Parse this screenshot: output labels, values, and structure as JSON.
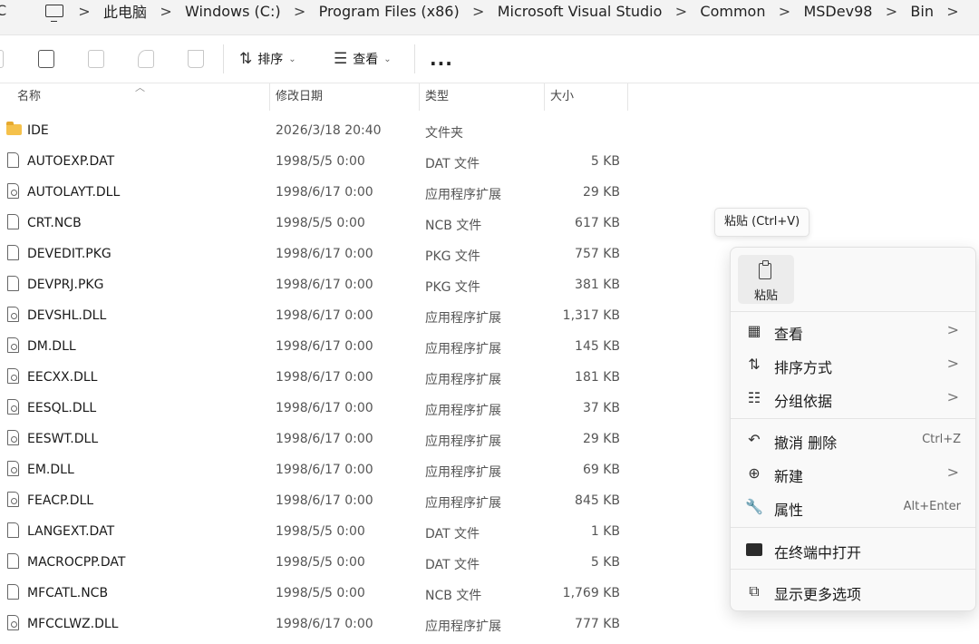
{
  "address": {
    "back_glyph": "C",
    "crumbs": [
      "此电脑",
      "Windows (C:)",
      "Program Files (x86)",
      "Microsoft Visual Studio",
      "Common",
      "MSDev98",
      "Bin"
    ],
    "separator": ">"
  },
  "toolbar": {
    "sort_label": "排序",
    "view_label": "查看",
    "more_label": "..."
  },
  "columns": {
    "name": "名称",
    "date": "修改日期",
    "type": "类型",
    "size": "大小"
  },
  "files": [
    {
      "name": "IDE",
      "date": "2026/3/18 20:40",
      "type": "文件夹",
      "size": "",
      "kind": "folder"
    },
    {
      "name": "AUTOEXP.DAT",
      "date": "1998/5/5 0:00",
      "type": "DAT 文件",
      "size": "5 KB",
      "kind": "file"
    },
    {
      "name": "AUTOLAYT.DLL",
      "date": "1998/6/17 0:00",
      "type": "应用程序扩展",
      "size": "29 KB",
      "kind": "dll"
    },
    {
      "name": "CRT.NCB",
      "date": "1998/5/5 0:00",
      "type": "NCB 文件",
      "size": "617 KB",
      "kind": "file"
    },
    {
      "name": "DEVEDIT.PKG",
      "date": "1998/6/17 0:00",
      "type": "PKG 文件",
      "size": "757 KB",
      "kind": "file"
    },
    {
      "name": "DEVPRJ.PKG",
      "date": "1998/6/17 0:00",
      "type": "PKG 文件",
      "size": "381 KB",
      "kind": "file"
    },
    {
      "name": "DEVSHL.DLL",
      "date": "1998/6/17 0:00",
      "type": "应用程序扩展",
      "size": "1,317 KB",
      "kind": "dll"
    },
    {
      "name": "DM.DLL",
      "date": "1998/6/17 0:00",
      "type": "应用程序扩展",
      "size": "145 KB",
      "kind": "dll"
    },
    {
      "name": "EECXX.DLL",
      "date": "1998/6/17 0:00",
      "type": "应用程序扩展",
      "size": "181 KB",
      "kind": "dll"
    },
    {
      "name": "EESQL.DLL",
      "date": "1998/6/17 0:00",
      "type": "应用程序扩展",
      "size": "37 KB",
      "kind": "dll"
    },
    {
      "name": "EESWT.DLL",
      "date": "1998/6/17 0:00",
      "type": "应用程序扩展",
      "size": "29 KB",
      "kind": "dll"
    },
    {
      "name": "EM.DLL",
      "date": "1998/6/17 0:00",
      "type": "应用程序扩展",
      "size": "69 KB",
      "kind": "dll"
    },
    {
      "name": "FEACP.DLL",
      "date": "1998/6/17 0:00",
      "type": "应用程序扩展",
      "size": "845 KB",
      "kind": "dll"
    },
    {
      "name": "LANGEXT.DAT",
      "date": "1998/5/5 0:00",
      "type": "DAT 文件",
      "size": "1 KB",
      "kind": "file"
    },
    {
      "name": "MACROCPP.DAT",
      "date": "1998/5/5 0:00",
      "type": "DAT 文件",
      "size": "5 KB",
      "kind": "file"
    },
    {
      "name": "MFCATL.NCB",
      "date": "1998/5/5 0:00",
      "type": "NCB 文件",
      "size": "1,769 KB",
      "kind": "file"
    },
    {
      "name": "MFCCLWZ.DLL",
      "date": "1998/6/17 0:00",
      "type": "应用程序扩展",
      "size": "777 KB",
      "kind": "dll"
    }
  ],
  "tooltip": "粘贴 (Ctrl+V)",
  "context_menu": {
    "paste_label": "粘贴",
    "items": [
      {
        "label": "查看",
        "shortcut": "",
        "arrow": ">",
        "icon": "grid-icon"
      },
      {
        "label": "排序方式",
        "shortcut": "",
        "arrow": ">",
        "icon": "sort-icon"
      },
      {
        "label": "分组依据",
        "shortcut": "",
        "arrow": ">",
        "icon": "group-icon"
      },
      {
        "label": "撤消 删除",
        "shortcut": "Ctrl+Z",
        "arrow": "",
        "icon": "undo-icon"
      },
      {
        "label": "新建",
        "shortcut": "",
        "arrow": ">",
        "icon": "new-icon"
      },
      {
        "label": "属性",
        "shortcut": "Alt+Enter",
        "arrow": "",
        "icon": "wrench-icon"
      },
      {
        "label": "在终端中打开",
        "shortcut": "",
        "arrow": "",
        "icon": "terminal-icon"
      },
      {
        "label": "显示更多选项",
        "shortcut": "",
        "arrow": "",
        "icon": "more-options-icon"
      }
    ]
  }
}
